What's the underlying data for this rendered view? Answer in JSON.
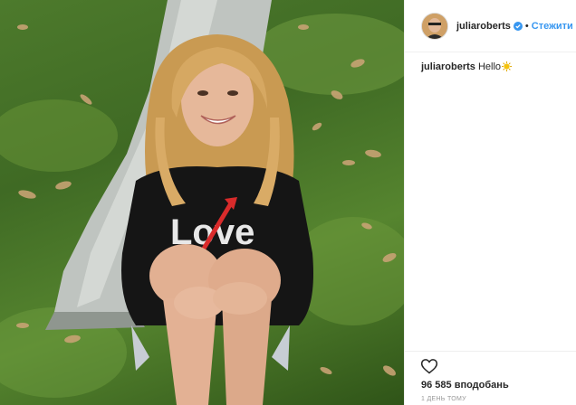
{
  "post": {
    "sweater_text": "Love",
    "author": {
      "username": "juliaroberts",
      "verified": true,
      "follow_label": "Стежити"
    },
    "caption": {
      "username": "juliaroberts",
      "text": "Hello",
      "emoji": "sun-emoji"
    },
    "likes_text": "96 585 вподобань",
    "time_text": "1 ДЕНЬ ТОМУ"
  },
  "colors": {
    "accent": "#3897f0",
    "text": "#262626",
    "muted": "#999999",
    "border": "#efefef",
    "sun": "#f4c20d"
  }
}
